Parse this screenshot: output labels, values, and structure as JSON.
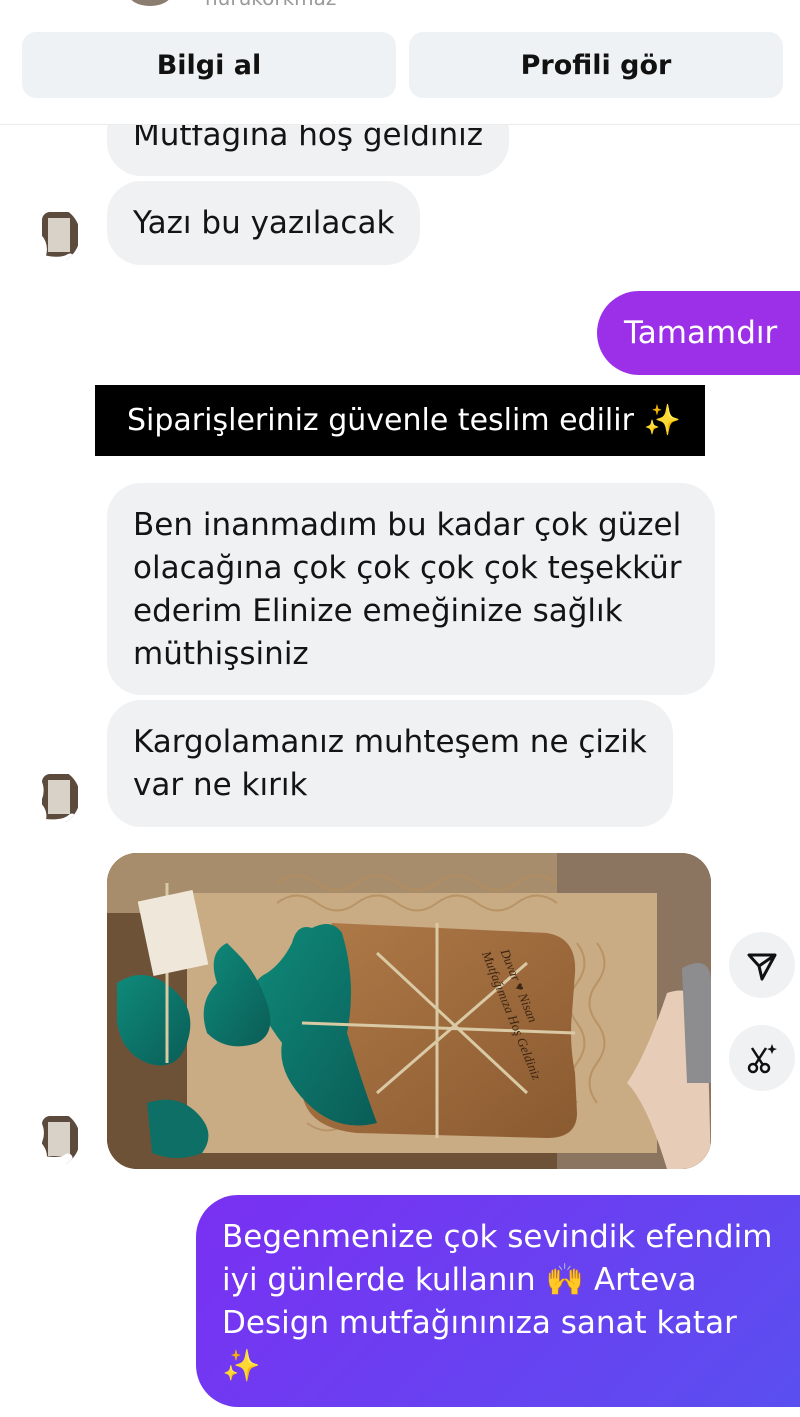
{
  "header": {
    "username": "nurukorkmaz",
    "info_button": "Bilgi al",
    "profile_button": "Profili gör"
  },
  "messages": {
    "m1": "Mutfağına hoş geldiniz",
    "m2": "Yazı bu yazılacak",
    "m3": "Tamamdır",
    "banner": "Siparişleriniz güvenle teslim edilir ✨",
    "m4_lines": [
      "Ben inanmadım bu kadar çok güzel",
      "olacağına çok çok çok çok teşekkür",
      "ederim Elinize emeğinize sağlık",
      "müthişsiniz"
    ],
    "m5_lines": [
      "Kargolamanız muhteşem ne çizik",
      "var ne kırık"
    ],
    "m6_lines": [
      "Begenmenize çok sevindik efendim",
      "iyi günlerde kullanın 🙌 Arteva",
      "Design mutfağınınıza sanat katar",
      "✨"
    ]
  },
  "photo": {
    "engraving_lines": [
      "Duvar ♥ Nisan",
      "Mutfağımıza Hoş Geldiniz"
    ]
  },
  "icons": {
    "share": "share-icon",
    "edit": "magic-edit-icon"
  },
  "colors": {
    "incoming_bubble": "#f0f1f3",
    "outgoing_purple": "#9b30e8",
    "outgoing_gradient_start": "#7a30f2",
    "outgoing_gradient_end": "#5a4ff0",
    "banner_bg": "#000000"
  }
}
